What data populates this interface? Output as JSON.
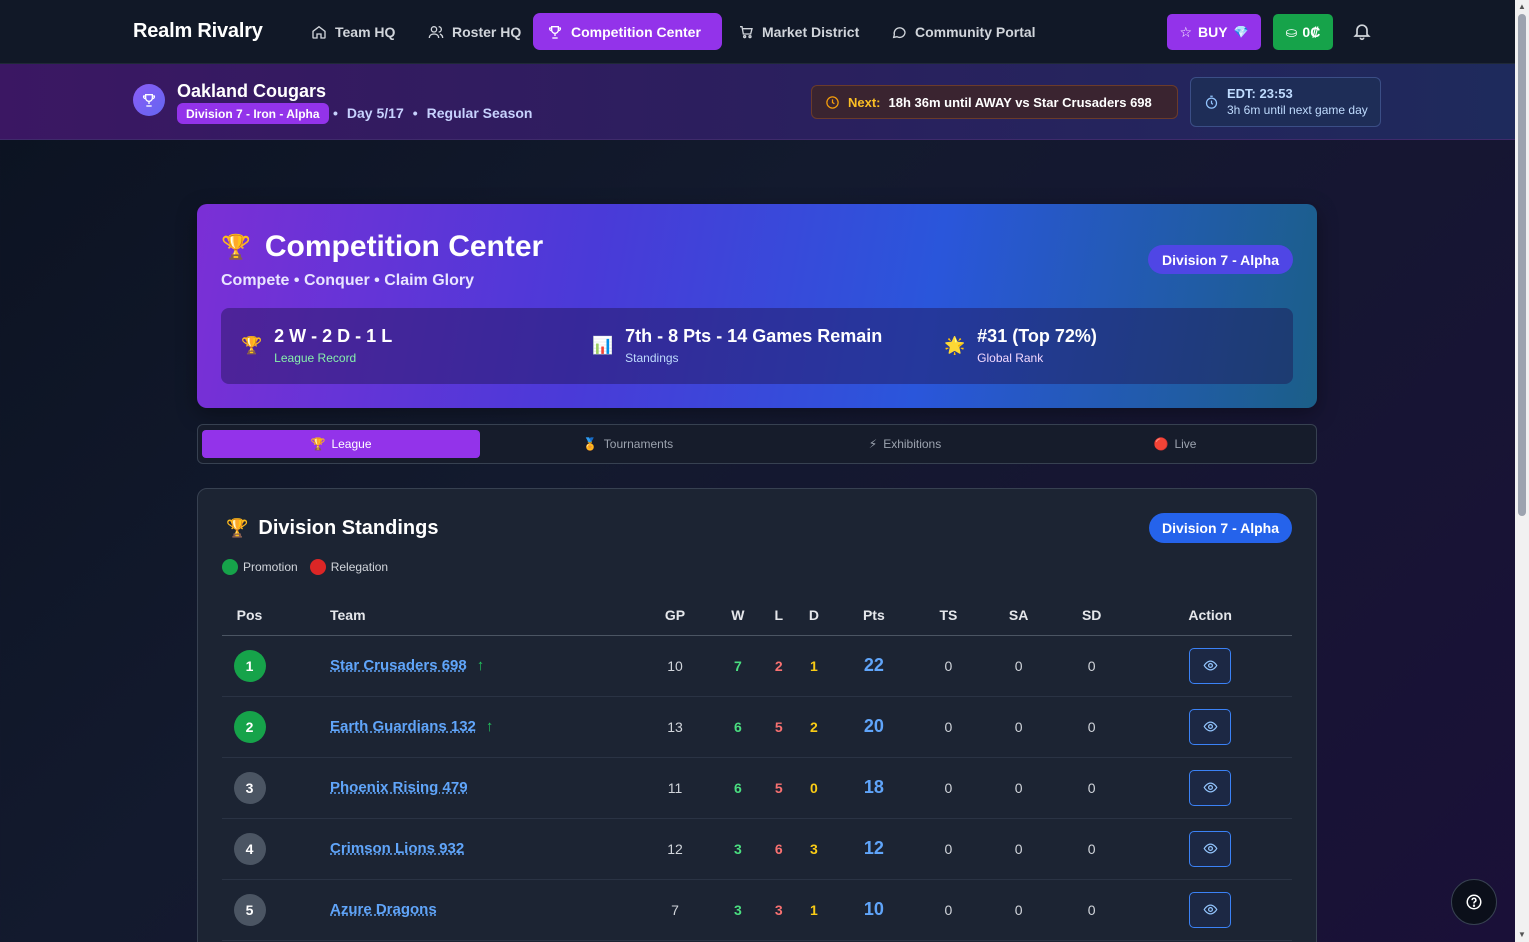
{
  "nav": {
    "brand": "Realm Rivalry",
    "items": [
      {
        "label": "Team HQ",
        "icon": "home-icon"
      },
      {
        "label": "Roster HQ",
        "icon": "users-icon"
      },
      {
        "label": "Competition Center",
        "icon": "trophy-icon",
        "active": true
      },
      {
        "label": "Market District",
        "icon": "cart-icon"
      },
      {
        "label": "Community Portal",
        "icon": "chat-icon"
      }
    ],
    "buy_label": "BUY",
    "credits_label": "0₡"
  },
  "team": {
    "name": "Oakland Cougars",
    "division": "Division 7 - Iron - Alpha",
    "day": "Day 5/17",
    "season": "Regular Season",
    "next_label": "Next:",
    "next_text": "18h 36m until AWAY vs Star Crusaders 698",
    "edt_time": "EDT: 23:53",
    "edt_sub": "3h 6m until next game day"
  },
  "hero": {
    "title": "Competition Center",
    "subtitle": "Compete • Conquer • Claim Glory",
    "badge": "Division 7 - Alpha",
    "stats": [
      {
        "value": "2 W - 2 D - 1 L",
        "label": "League Record",
        "icon": "trophy-icon",
        "glyph": "🏆",
        "color": "#86efac"
      },
      {
        "value": "7th - 8 Pts - 14 Games Remain",
        "label": "Standings",
        "icon": "chart-icon",
        "glyph": "📊",
        "color": "#bfdbfe"
      },
      {
        "value": "#31 (Top 72%)",
        "label": "Global Rank",
        "icon": "star-icon",
        "glyph": "🌟",
        "color": "#f3d9ff"
      }
    ]
  },
  "tabs": [
    {
      "label": "League",
      "glyph": "🏆",
      "active": true
    },
    {
      "label": "Tournaments",
      "glyph": "🏅"
    },
    {
      "label": "Exhibitions",
      "glyph": "⚡"
    },
    {
      "label": "Live",
      "glyph": "🔴"
    }
  ],
  "standings": {
    "title": "Division Standings",
    "badge": "Division 7 - Alpha",
    "legend": [
      {
        "label": "Promotion",
        "color": "#16a34a"
      },
      {
        "label": "Relegation",
        "color": "#dc2626"
      }
    ],
    "headers": [
      "Pos",
      "Team",
      "GP",
      "W",
      "L",
      "D",
      "Pts",
      "TS",
      "SA",
      "SD",
      "Action"
    ],
    "rows": [
      {
        "pos": "1",
        "team": "Star Crusaders 698",
        "promo": true,
        "gp": "10",
        "w": "7",
        "l": "2",
        "d": "1",
        "pts": "22",
        "ts": "0",
        "sa": "0",
        "sd": "0"
      },
      {
        "pos": "2",
        "team": "Earth Guardians 132",
        "promo": true,
        "gp": "13",
        "w": "6",
        "l": "5",
        "d": "2",
        "pts": "20",
        "ts": "0",
        "sa": "0",
        "sd": "0"
      },
      {
        "pos": "3",
        "team": "Phoenix Rising 479",
        "promo": false,
        "gp": "11",
        "w": "6",
        "l": "5",
        "d": "0",
        "pts": "18",
        "ts": "0",
        "sa": "0",
        "sd": "0"
      },
      {
        "pos": "4",
        "team": "Crimson Lions 932",
        "promo": false,
        "gp": "12",
        "w": "3",
        "l": "6",
        "d": "3",
        "pts": "12",
        "ts": "0",
        "sa": "0",
        "sd": "0"
      },
      {
        "pos": "5",
        "team": "Azure Dragons",
        "promo": false,
        "gp": "7",
        "w": "3",
        "l": "3",
        "d": "1",
        "pts": "10",
        "ts": "0",
        "sa": "0",
        "sd": "0"
      }
    ]
  }
}
